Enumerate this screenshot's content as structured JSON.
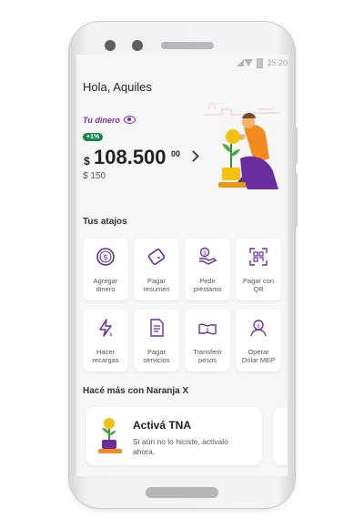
{
  "status_bar": {
    "time": "15:20"
  },
  "home": {
    "greeting": "Hola, Aquiles",
    "money_label": "Tu dinero",
    "badge": "+1%",
    "currency": "$",
    "amount": "108.500",
    "cents": "00",
    "secondary_amount": "$ 150"
  },
  "shortcuts": {
    "title": "Tus atajos",
    "items": [
      {
        "label_1": "Agregar",
        "label_2": "dinero",
        "icon": "dollar-coin-icon"
      },
      {
        "label_1": "Pagar",
        "label_2": "resumen",
        "icon": "card-icon"
      },
      {
        "label_1": "Pedir",
        "label_2": "préstamo",
        "icon": "hand-money-icon"
      },
      {
        "label_1": "Pagar con",
        "label_2": "QR",
        "icon": "qr-icon"
      },
      {
        "label_1": "Hacer",
        "label_2": "recargas",
        "icon": "lightning-icon"
      },
      {
        "label_1": "Pagar",
        "label_2": "servicios",
        "icon": "receipt-icon"
      },
      {
        "label_1": "Transferir",
        "label_2": "pesos",
        "icon": "bills-icon"
      },
      {
        "label_1": "Operar",
        "label_2": "Dólar MEP",
        "icon": "person-icon"
      }
    ]
  },
  "more": {
    "title": "Hacé más con Naranja X",
    "promo_title": "Activá TNA",
    "promo_desc": "Si aún no lo hiciste, activalo ahora."
  },
  "colors": {
    "accent": "#7b2fa1",
    "badge": "#17864a",
    "orange": "#f28b1e"
  }
}
